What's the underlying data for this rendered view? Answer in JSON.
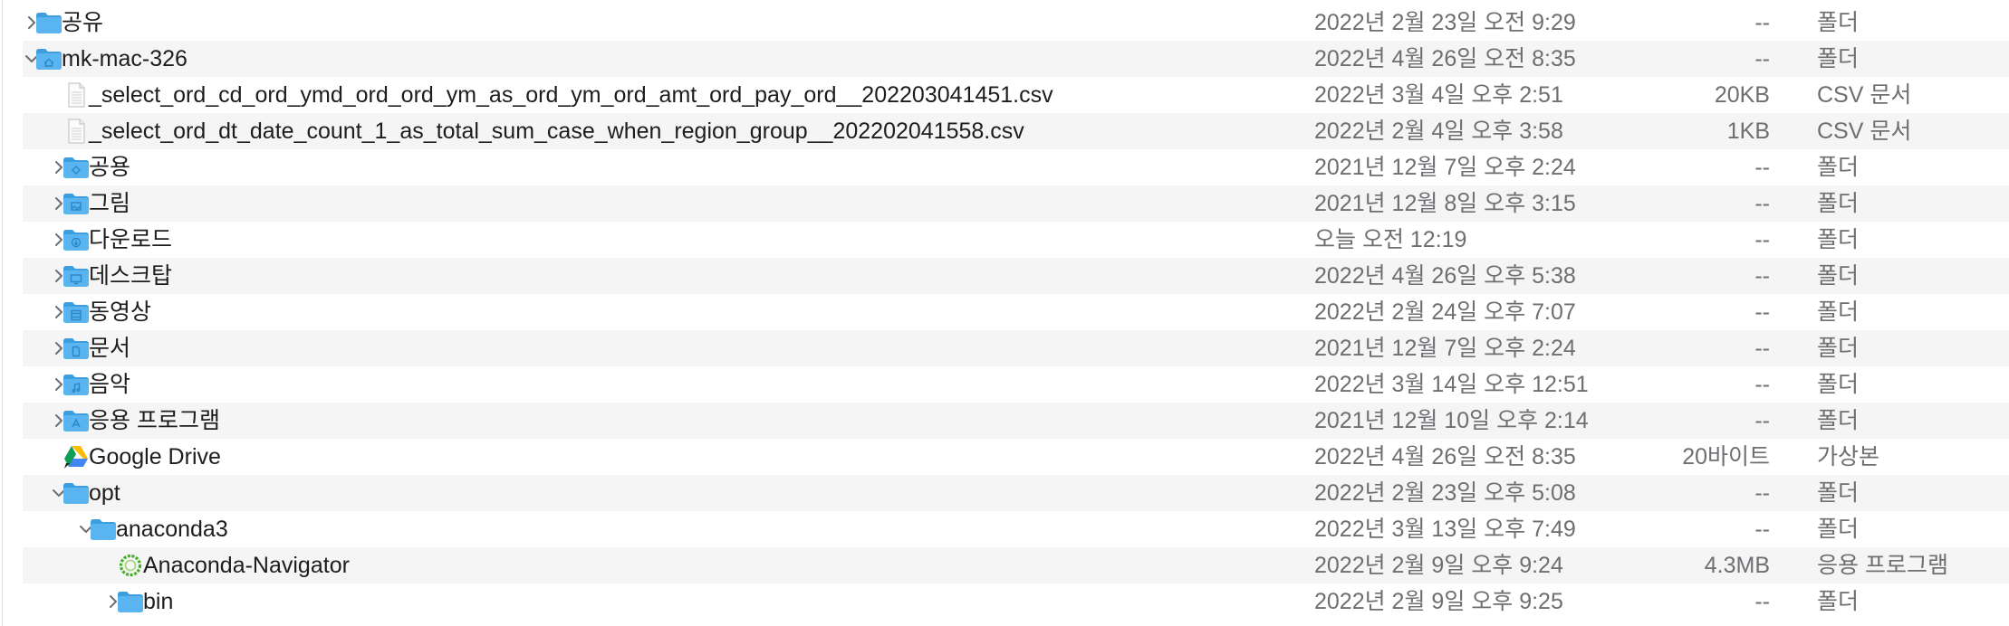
{
  "rows": [
    {
      "name": "공유",
      "date": "2022년 2월 23일 오전 9:29",
      "size": "--",
      "kind": "폴더",
      "icon": "folder-icon",
      "chevron": "collapsed",
      "depth": 0
    },
    {
      "name": "mk-mac-326",
      "date": "2022년 4월 26일 오전 8:35",
      "size": "--",
      "kind": "폴더",
      "icon": "home-folder-icon",
      "chevron": "expanded",
      "depth": 0
    },
    {
      "name": "_select_ord_cd_ord_ymd_ord_ord_ym_as_ord_ym_ord_amt_ord_pay_ord__202203041451.csv",
      "date": "2022년 3월 4일 오후 2:51",
      "size": "20KB",
      "kind": "CSV 문서",
      "icon": "csv-document-icon",
      "chevron": "none",
      "depth": 1
    },
    {
      "name": "_select_ord_dt_date_count_1_as_total_sum_case_when_region_group__202202041558.csv",
      "date": "2022년 2월 4일 오후 3:58",
      "size": "1KB",
      "kind": "CSV 문서",
      "icon": "csv-document-icon",
      "chevron": "none",
      "depth": 1
    },
    {
      "name": "공용",
      "date": "2021년 12월 7일 오후 2:24",
      "size": "--",
      "kind": "폴더",
      "icon": "public-folder-icon",
      "chevron": "collapsed",
      "depth": 1
    },
    {
      "name": "그림",
      "date": "2021년 12월 8일 오후 3:15",
      "size": "--",
      "kind": "폴더",
      "icon": "pictures-folder-icon",
      "chevron": "collapsed",
      "depth": 1
    },
    {
      "name": "다운로드",
      "date": "오늘 오전 12:19",
      "size": "--",
      "kind": "폴더",
      "icon": "downloads-folder-icon",
      "chevron": "collapsed",
      "depth": 1
    },
    {
      "name": "데스크탑",
      "date": "2022년 4월 26일 오후 5:38",
      "size": "--",
      "kind": "폴더",
      "icon": "desktop-folder-icon",
      "chevron": "collapsed",
      "depth": 1
    },
    {
      "name": "동영상",
      "date": "2022년 2월 24일 오후 7:07",
      "size": "--",
      "kind": "폴더",
      "icon": "movies-folder-icon",
      "chevron": "collapsed",
      "depth": 1
    },
    {
      "name": "문서",
      "date": "2021년 12월 7일 오후 2:24",
      "size": "--",
      "kind": "폴더",
      "icon": "documents-folder-icon",
      "chevron": "collapsed",
      "depth": 1
    },
    {
      "name": "음악",
      "date": "2022년 3월 14일 오후 12:51",
      "size": "--",
      "kind": "폴더",
      "icon": "music-folder-icon",
      "chevron": "collapsed",
      "depth": 1
    },
    {
      "name": "응용 프로그램",
      "date": "2021년 12월 10일 오후 2:14",
      "size": "--",
      "kind": "폴더",
      "icon": "applications-folder-icon",
      "chevron": "collapsed",
      "depth": 1
    },
    {
      "name": "Google Drive",
      "date": "2022년 4월 26일 오전 8:35",
      "size": "20바이트",
      "kind": "가상본",
      "icon": "google-drive-icon",
      "chevron": "none",
      "depth": 1
    },
    {
      "name": "opt",
      "date": "2022년 2월 23일 오후 5:08",
      "size": "--",
      "kind": "폴더",
      "icon": "folder-icon",
      "chevron": "expanded",
      "depth": 1
    },
    {
      "name": "anaconda3",
      "date": "2022년 3월 13일 오후 7:49",
      "size": "--",
      "kind": "폴더",
      "icon": "folder-icon",
      "chevron": "expanded",
      "depth": 2
    },
    {
      "name": "Anaconda-Navigator",
      "date": "2022년 2월 9일 오후 9:24",
      "size": "4.3MB",
      "kind": "응용 프로그램",
      "icon": "anaconda-navigator-icon",
      "chevron": "none",
      "depth": 3
    },
    {
      "name": "bin",
      "date": "2022년 2월 9일 오후 9:25",
      "size": "--",
      "kind": "폴더",
      "icon": "folder-icon",
      "chevron": "collapsed",
      "depth": 3
    }
  ],
  "colors": {
    "folder": "#5ab4ef",
    "folder_dark": "#3e9fe0",
    "alt_row": "#f5f5f5",
    "secondary_text": "#6e6e73"
  }
}
